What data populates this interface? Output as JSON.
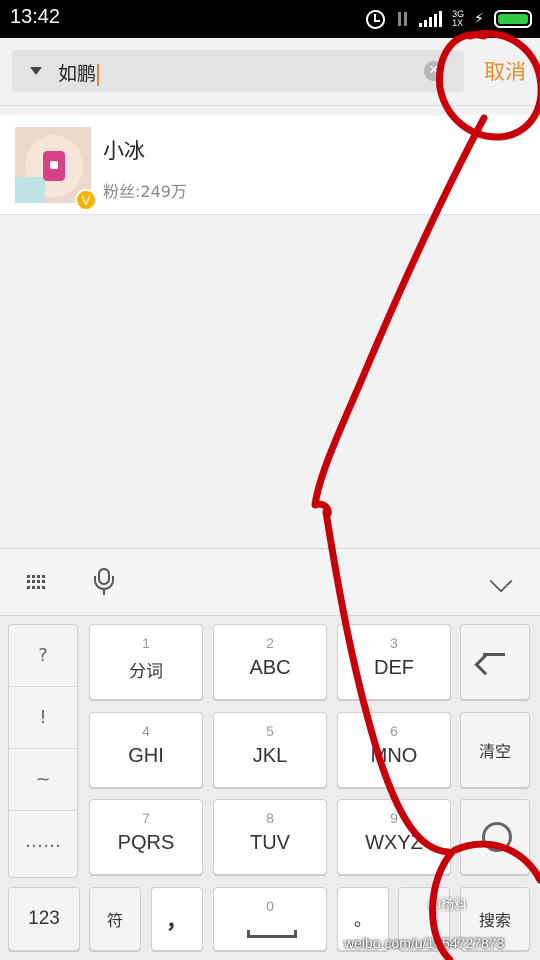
{
  "status_bar": {
    "time": "13:42",
    "network_type": "3G",
    "network_sub": "1X",
    "icons": [
      "alarm-icon",
      "data-arrows-icon",
      "signal-icon",
      "charging-icon",
      "battery-icon"
    ]
  },
  "search": {
    "query": "如鹏",
    "cancel_label": "取消",
    "accent_color": "#e88b2c"
  },
  "results": [
    {
      "name": "小冰",
      "fans": "粉丝:249万",
      "verified_badge": "V"
    }
  ],
  "keyboard": {
    "toolbar_icons": [
      "keyboard-grid-icon",
      "microphone-icon",
      "collapse-keyboard-icon"
    ],
    "punctuation": [
      "?",
      "!",
      "~",
      "……"
    ],
    "keys": [
      {
        "num": "1",
        "letters": "分词"
      },
      {
        "num": "2",
        "letters": "ABC"
      },
      {
        "num": "3",
        "letters": "DEF"
      },
      {
        "num": "4",
        "letters": "GHI"
      },
      {
        "num": "5",
        "letters": "JKL"
      },
      {
        "num": "6",
        "letters": "MNO"
      },
      {
        "num": "7",
        "letters": "PQRS"
      },
      {
        "num": "8",
        "letters": "TUV"
      },
      {
        "num": "9",
        "letters": "WXYZ"
      }
    ],
    "clear_label": "清空",
    "bottom_row": {
      "numbers_label": "123",
      "symbols_label": "符",
      "comma_label": "，",
      "space_num": "0",
      "period_label": "。",
      "search_label": "搜索"
    }
  },
  "watermark": {
    "handle": "@杨料",
    "url": "weibo.com/u/1654727873"
  },
  "annotation_color": "#c8000a"
}
